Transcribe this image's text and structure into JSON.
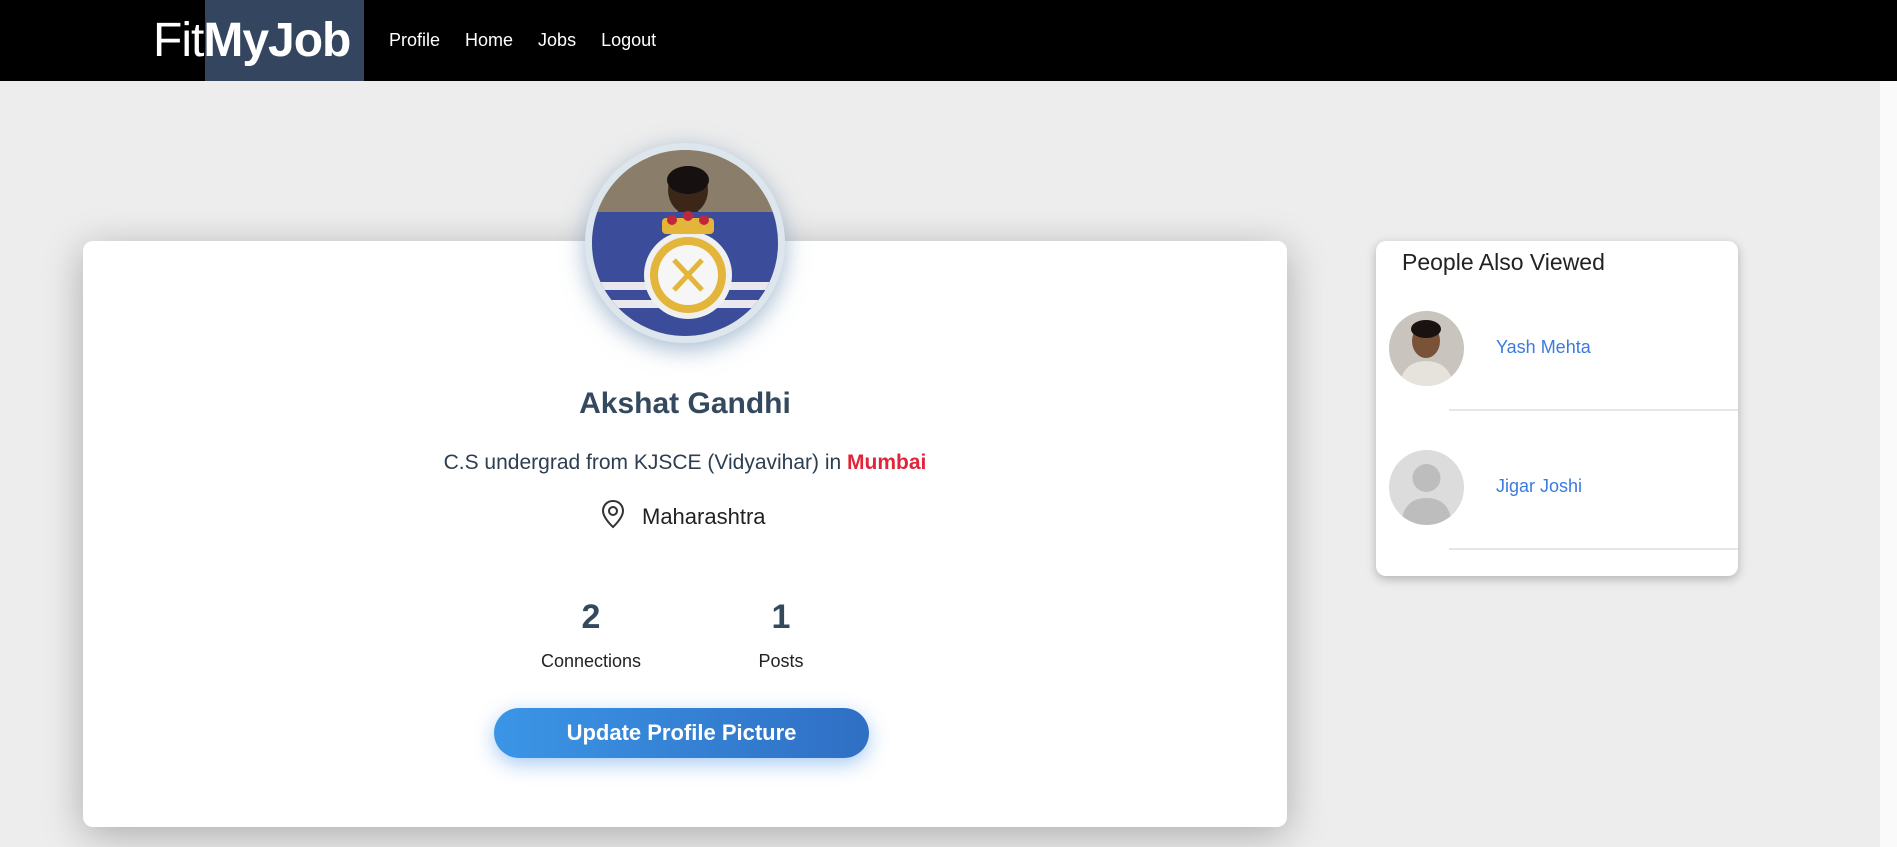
{
  "navbar": {
    "brand_part1": "Fit",
    "brand_part2": "MyJob",
    "links": [
      {
        "label": "Profile"
      },
      {
        "label": "Home"
      },
      {
        "label": "Jobs"
      },
      {
        "label": "Logout"
      }
    ]
  },
  "profile": {
    "name": "Akshat Gandhi",
    "headline_prefix": "C.S undergrad from KJSCE (Vidyavihar) in ",
    "headline_city": "Mumbai",
    "location_icon": "map-pin-icon",
    "location": "Maharashtra",
    "stats": [
      {
        "value": "2",
        "label": "Connections"
      },
      {
        "value": "1",
        "label": "Posts"
      }
    ],
    "update_button": "Update Profile Picture"
  },
  "side_panel": {
    "title": "People Also Viewed",
    "people": [
      {
        "name": "Yash Mehta"
      },
      {
        "name": "Jigar Joshi"
      }
    ]
  },
  "colors": {
    "navbar_bg": "#000000",
    "brand_highlight": "#34465f",
    "name_color": "#34495e",
    "city_color": "#e0243a",
    "link_blue": "#3a7be0",
    "button_gradient_start": "#3b95e6",
    "button_gradient_end": "#2f6fc4"
  }
}
